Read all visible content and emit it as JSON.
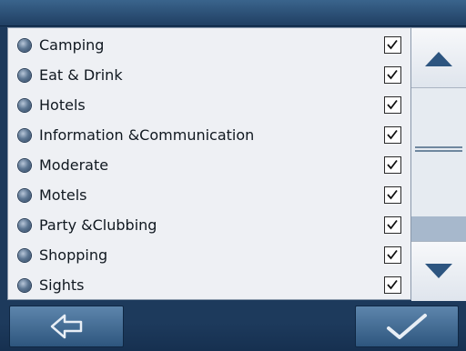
{
  "categories": [
    {
      "label": "Camping",
      "checked": true
    },
    {
      "label": "Eat & Drink",
      "checked": true
    },
    {
      "label": "Hotels",
      "checked": true
    },
    {
      "label": "Information &Communication",
      "checked": true
    },
    {
      "label": "Moderate",
      "checked": true
    },
    {
      "label": "Motels",
      "checked": true
    },
    {
      "label": "Party &Clubbing",
      "checked": true
    },
    {
      "label": "Shopping",
      "checked": true
    },
    {
      "label": "Sights",
      "checked": true
    }
  ],
  "icons": {
    "back": "back-arrow-icon",
    "confirm": "checkmark-icon",
    "scroll_up": "triangle-up-icon",
    "scroll_down": "triangle-down-icon",
    "bullet": "bullet-dot-icon"
  },
  "colors": {
    "background": "#1d3a5c",
    "list_background": "#eef0f4",
    "button": "#4a739b",
    "scroll_thumb": "#a7b8cc"
  }
}
